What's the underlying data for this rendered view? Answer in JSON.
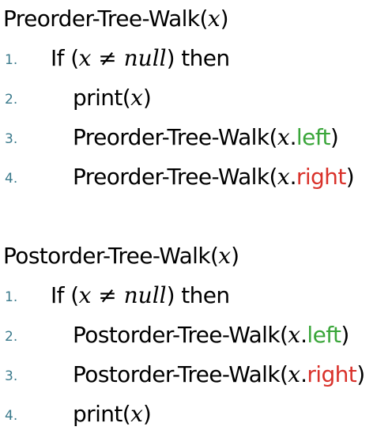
{
  "preorder": {
    "title": "Preorder-Tree-Walk",
    "param": "x",
    "lines": [
      {
        "num": "1.",
        "kw_if": "If",
        "cond_open": "(",
        "cond_var": "x",
        "cond_op": " ≠ ",
        "cond_null": "null",
        "cond_close": ")",
        "kw_then": " then"
      },
      {
        "num": "2.",
        "fn": "print",
        "arg": "x"
      },
      {
        "num": "3.",
        "fn": "Preorder-Tree-Walk",
        "arg": "x",
        "field": "left"
      },
      {
        "num": "4.",
        "fn": "Preorder-Tree-Walk",
        "arg": "x",
        "field": "right"
      }
    ]
  },
  "postorder": {
    "title": "Postorder-Tree-Walk",
    "param": "x",
    "lines": [
      {
        "num": "1.",
        "kw_if": "If",
        "cond_open": "(",
        "cond_var": "x",
        "cond_op": " ≠ ",
        "cond_null": "null",
        "cond_close": ")",
        "kw_then": " then"
      },
      {
        "num": "2.",
        "fn": "Postorder-Tree-Walk",
        "arg": "x",
        "field": "left"
      },
      {
        "num": "3.",
        "fn": "Postorder-Tree-Walk",
        "arg": "x",
        "field": "right"
      },
      {
        "num": "4.",
        "fn": "print",
        "arg": "x"
      }
    ]
  },
  "colors": {
    "line_number": "#3b7a8c",
    "left_field": "#3aa63a",
    "right_field": "#d9312a",
    "text": "#000000"
  }
}
